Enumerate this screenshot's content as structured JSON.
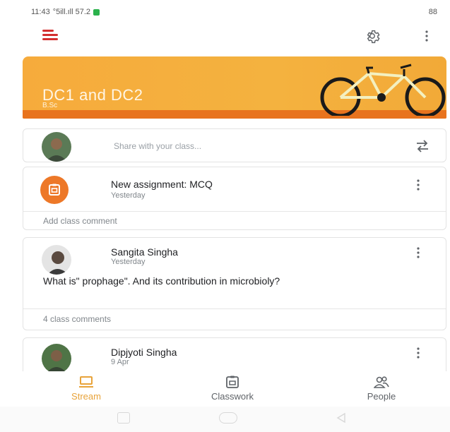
{
  "status_bar": {
    "time": "11:43",
    "signal_text": "°5ill.ıll 57.2 ",
    "battery": "88"
  },
  "app_bar": {
    "menu_icon": "menu-icon",
    "settings_icon": "settings-icon",
    "more_icon": "more-vert-icon"
  },
  "banner": {
    "title": "DC1 and DC2",
    "subtitle": "B.Sc"
  },
  "share": {
    "placeholder": "Share with your class..."
  },
  "assignment": {
    "title": "New assignment: MCQ",
    "time": "Yesterday",
    "comment": "Add class comment"
  },
  "post": {
    "author": "Sangita Singha",
    "time": "Yesterday",
    "body": "What is\" prophage\". And its contribution in microbioly?",
    "comments": "4 class comments"
  },
  "post3": {
    "author": "Dipjyoti Singha",
    "time": "9 Apr"
  },
  "bottom_nav": {
    "stream": "Stream",
    "classwork": "Classwork",
    "people": "People"
  },
  "colors": {
    "accent": "#e8a33a",
    "banner": "#f4b23f",
    "assignment_icon": "#ed7828"
  }
}
